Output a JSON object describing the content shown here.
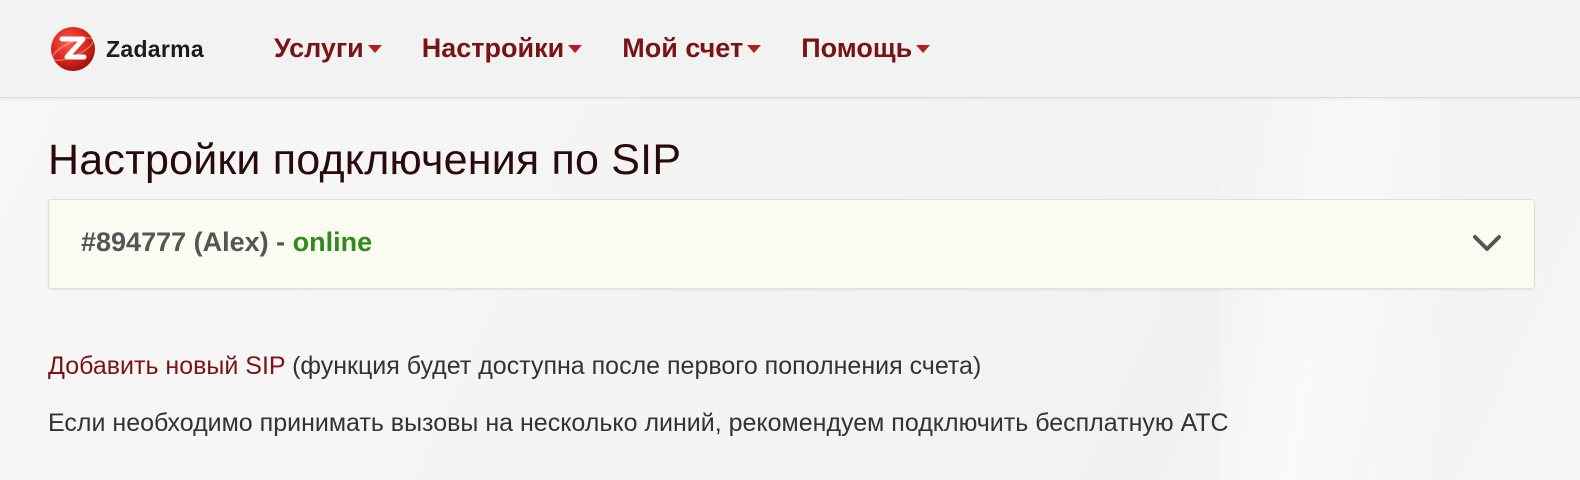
{
  "header": {
    "logo_text": "Zadarma",
    "logo_icon": "zadarma-logo-icon",
    "nav": [
      {
        "label": "Услуги"
      },
      {
        "label": "Настройки"
      },
      {
        "label": "Мой счет"
      },
      {
        "label": "Помощь"
      }
    ]
  },
  "main": {
    "title": "Настройки подключения по SIP",
    "sip_account": {
      "id_name": "#894777 (Alex) - ",
      "status": "online",
      "status_color": "#2e8b1e",
      "toggle_icon": "chevron-down-icon"
    },
    "add_sip": {
      "link": "Добавить новый SIP",
      "note": " (функция будет доступна после первого пополнения счета)"
    },
    "multi_line_hint": "Если необходимо принимать вызовы на несколько линий, рекомендуем подключить бесплатную АТС"
  },
  "colors": {
    "brand": "#7a1414",
    "caret": "#b31f1f",
    "panel_bg": "#fcfbf2"
  }
}
